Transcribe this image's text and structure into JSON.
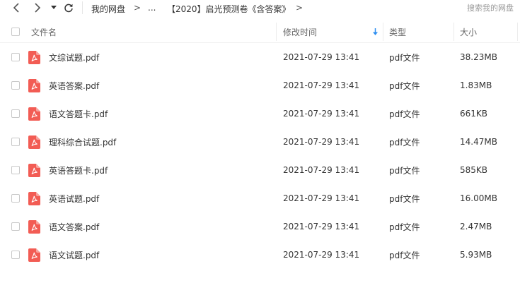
{
  "toolbar": {
    "back_icon": "chevron-left-icon",
    "forward_icon": "chevron-right-icon",
    "history_icon": "caret-down-icon",
    "refresh_icon": "refresh-icon",
    "breadcrumb": {
      "root": "我的网盘",
      "sep1": ">",
      "ellipsis": "...",
      "current": "【2020】启光预测卷《含答案》",
      "sep2": ">"
    },
    "search_placeholder": "搜索我的网盘"
  },
  "columns": {
    "name": "文件名",
    "modified": "修改时间",
    "type": "类型",
    "size": "大小"
  },
  "sort_icon": "arrow-down-icon",
  "accent_color": "#2e8ff0",
  "pdf_color": "#f25c54",
  "files": [
    {
      "name": "文综试题.pdf",
      "modified": "2021-07-29 13:41",
      "type": "pdf文件",
      "size": "38.23MB"
    },
    {
      "name": "英语答案.pdf",
      "modified": "2021-07-29 13:41",
      "type": "pdf文件",
      "size": "1.83MB"
    },
    {
      "name": "语文答题卡.pdf",
      "modified": "2021-07-29 13:41",
      "type": "pdf文件",
      "size": "661KB"
    },
    {
      "name": "理科综合试题.pdf",
      "modified": "2021-07-29 13:41",
      "type": "pdf文件",
      "size": "14.47MB"
    },
    {
      "name": "英语答题卡.pdf",
      "modified": "2021-07-29 13:41",
      "type": "pdf文件",
      "size": "585KB"
    },
    {
      "name": "英语试题.pdf",
      "modified": "2021-07-29 13:41",
      "type": "pdf文件",
      "size": "16.00MB"
    },
    {
      "name": "语文答案.pdf",
      "modified": "2021-07-29 13:41",
      "type": "pdf文件",
      "size": "2.47MB"
    },
    {
      "name": "语文试题.pdf",
      "modified": "2021-07-29 13:41",
      "type": "pdf文件",
      "size": "5.93MB"
    }
  ]
}
